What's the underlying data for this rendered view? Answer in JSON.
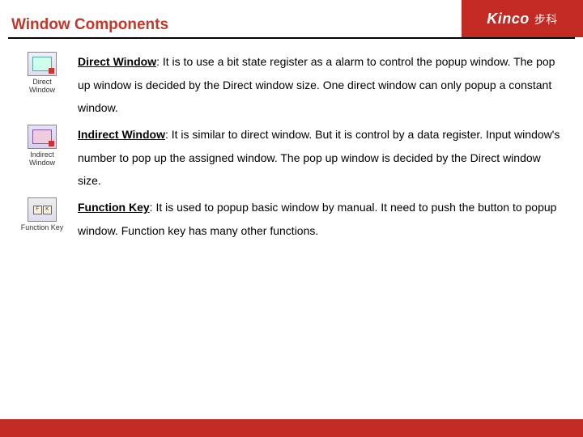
{
  "header": {
    "title": "Window Components",
    "logo_text": "Kinco",
    "logo_cn": "步科"
  },
  "sections": [
    {
      "icon_label": "Direct Window",
      "heading": "Direct Window",
      "body": ": It is to use a bit state register as a alarm to control the popup window. The pop up window is decided by the Direct window size. One direct window can only popup a constant window."
    },
    {
      "icon_label": "Indirect Window",
      "heading": "Indirect Window",
      "body": ": It is similar to direct window. But it is control by a data register.  Input window's number to pop up the assigned window. The pop up window is decided by the Direct window size."
    },
    {
      "icon_label": "Function Key",
      "heading": "Function Key",
      "body": ": It is used to popup basic window by manual. It need to push the button to popup window. Function key has many other functions."
    }
  ]
}
